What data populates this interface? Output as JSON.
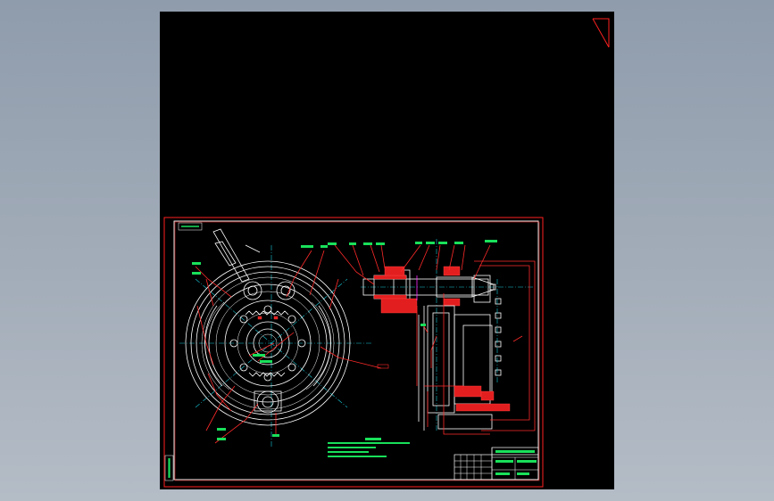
{
  "viewport": {
    "background": "#97a3b2"
  },
  "drawing": {
    "background": "#000000",
    "border_color": "#ff2020",
    "outline_color": "#ffffff",
    "centerline_color": "#17c7d6",
    "section_color": "#e31e1e",
    "dimension_color": "#19e05a"
  },
  "icons": {
    "front_view": "drum-brake-front-view",
    "section_view": "brake-assembly-section-view"
  }
}
